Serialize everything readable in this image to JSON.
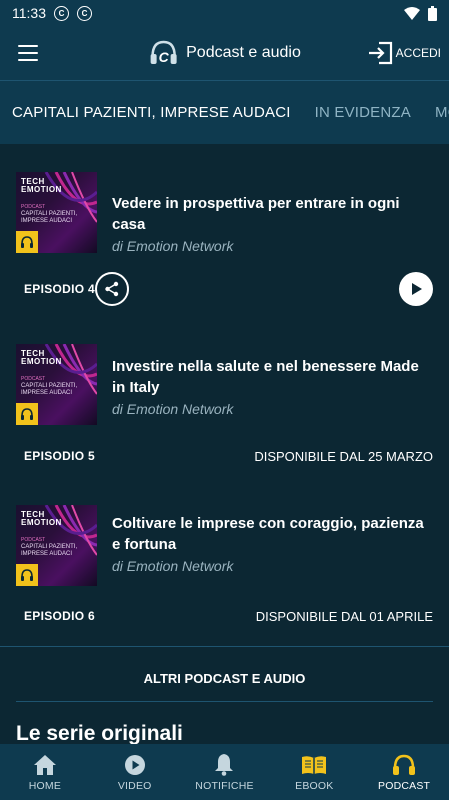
{
  "status": {
    "time": "11:33"
  },
  "appbar": {
    "title": "Podcast e audio",
    "login_label": "ACCEDI"
  },
  "tabs": [
    {
      "label": "CAPITALI PAZIENTI, IMPRESE AUDACI",
      "active": true
    },
    {
      "label": "IN EVIDENZA",
      "active": false
    },
    {
      "label": "MORIRE",
      "active": false
    }
  ],
  "cover": {
    "tech": "TECH",
    "emotion": "EMOTION",
    "podcast": "PODCAST",
    "title": "CAPITALI PAZIENTI, IMPRESE AUDACI"
  },
  "episodes": [
    {
      "title": "Vedere in prospettiva per entrare in ogni casa",
      "author": "di Emotion Network",
      "number": "EPISODIO 4",
      "availability": ""
    },
    {
      "title": "Investire nella salute e nel benessere Made in Italy",
      "author": "di Emotion Network",
      "number": "EPISODIO 5",
      "availability": "DISPONIBILE DAL 25 MARZO"
    },
    {
      "title": "Coltivare le imprese con coraggio, pazienza e fortuna",
      "author": "di Emotion Network",
      "number": "EPISODIO 6",
      "availability": "DISPONIBILE DAL 01 APRILE"
    }
  ],
  "more_label": "ALTRI PODCAST E AUDIO",
  "section_title": "Le serie originali",
  "bottomnav": [
    {
      "label": "HOME",
      "icon": "home-icon",
      "active": false
    },
    {
      "label": "VIDEO",
      "icon": "video-icon",
      "active": false
    },
    {
      "label": "NOTIFICHE",
      "icon": "bell-icon",
      "active": false
    },
    {
      "label": "EBOOK",
      "icon": "book-icon",
      "active": false
    },
    {
      "label": "PODCAST",
      "icon": "headphones-icon",
      "active": true
    }
  ],
  "colors": {
    "background": "#0c2733",
    "bar": "#0e3a4f",
    "accent": "#f2c21b"
  }
}
